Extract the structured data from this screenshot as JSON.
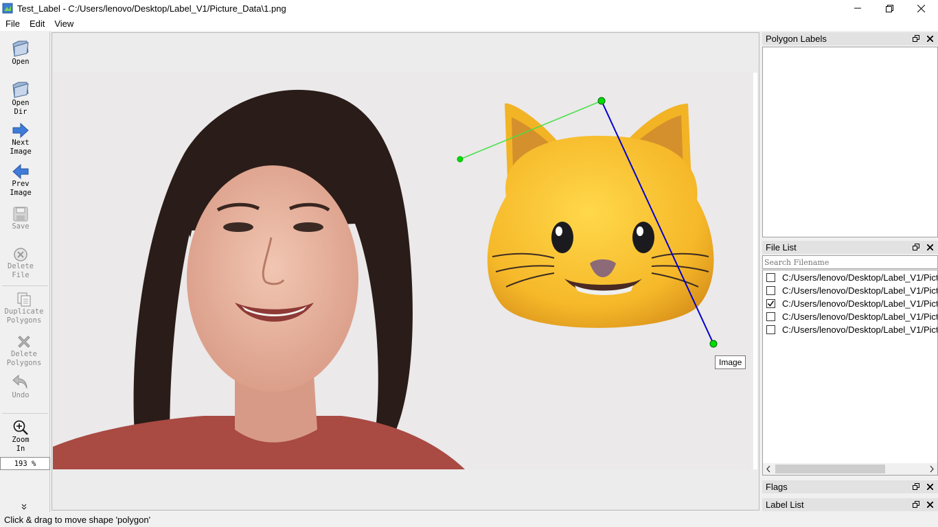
{
  "window": {
    "title": "Test_Label - C:/Users/lenovo/Desktop/Label_V1/Picture_Data\\1.png"
  },
  "menu": [
    "File",
    "Edit",
    "View"
  ],
  "toolbar": {
    "open": "Open",
    "open_dir": "Open\nDir",
    "next_image": "Next\nImage",
    "prev_image": "Prev\nImage",
    "save": "Save",
    "delete_file": "Delete\nFile",
    "duplicate_polygons": "Duplicate\nPolygons",
    "delete_polygons": "Delete\nPolygons",
    "undo": "Undo",
    "zoom_in": "Zoom\nIn",
    "zoom_value": "193 %",
    "more": "»"
  },
  "panels": {
    "polygon_labels": "Polygon Labels",
    "file_list": "File List",
    "flags": "Flags",
    "label_list": "Label List",
    "search_placeholder": "Search Filename",
    "files": [
      {
        "name": "C:/Users/lenovo/Desktop/Label_V1/Pictu",
        "checked": false
      },
      {
        "name": "C:/Users/lenovo/Desktop/Label_V1/Pictu",
        "checked": false
      },
      {
        "name": "C:/Users/lenovo/Desktop/Label_V1/Pictu",
        "checked": true
      },
      {
        "name": "C:/Users/lenovo/Desktop/Label_V1/Pictu",
        "checked": false
      },
      {
        "name": "C:/Users/lenovo/Desktop/Label_V1/Pictu",
        "checked": false
      }
    ]
  },
  "tooltip": "Image",
  "status": "Click & drag to move shape 'polygon'",
  "colors": {
    "polygon_fill_edge": "#40e040",
    "active_edge": "#0000cc",
    "vertex": "#00dd00"
  }
}
